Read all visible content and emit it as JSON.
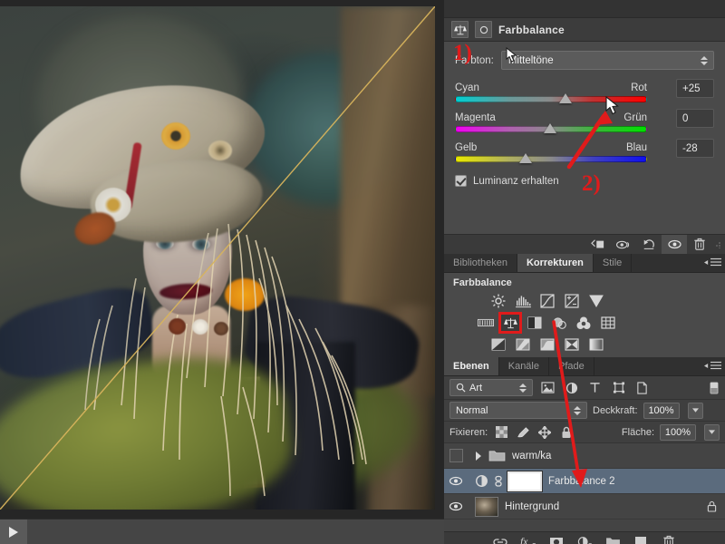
{
  "app": "Adobe Photoshop",
  "canvas": {
    "image_description": "Woman in Halloween scarecrow costume with burlap hat, straw hair and plaid top",
    "split_preview": "diagonal before/after divider",
    "player": {
      "play_label": "play-triangle"
    }
  },
  "properties_panel": {
    "title": "Farbbalance",
    "title_icon": "color-balance-icon",
    "clip_icon": "clip-to-layer-icon",
    "tone": {
      "label": "Farbton:",
      "value": "Mitteltöne"
    },
    "sliders": [
      {
        "left": "Cyan",
        "right": "Rot",
        "value": "+25",
        "thumb_pct": 57,
        "id": "cyan-red"
      },
      {
        "left": "Magenta",
        "right": "Grün",
        "value": "0",
        "thumb_pct": 49,
        "id": "magenta-green"
      },
      {
        "left": "Gelb",
        "right": "Blau",
        "value": "-28",
        "thumb_pct": 36,
        "id": "yellow-blue"
      }
    ],
    "preserve_luminosity": {
      "label": "Luminanz erhalten",
      "checked": true
    },
    "toolbar": [
      {
        "name": "clip-to-layer-button"
      },
      {
        "name": "view-previous-state-button"
      },
      {
        "name": "reset-button"
      },
      {
        "name": "toggle-visibility-button"
      },
      {
        "name": "delete-adjustment-button"
      }
    ]
  },
  "corrections_panel": {
    "tabs": [
      {
        "label": "Bibliotheken",
        "active": false
      },
      {
        "label": "Korrekturen",
        "active": true
      },
      {
        "label": "Stile",
        "active": false
      }
    ],
    "heading": "Farbbalance",
    "icon_rows": [
      [
        "brightness-contrast-icon",
        "levels-icon",
        "curves-icon",
        "exposure-icon",
        "vibrance-icon"
      ],
      [
        "hue-saturation-icon",
        "color-balance-icon",
        "black-white-icon",
        "photo-filter-icon",
        "channel-mixer-icon",
        "color-lookup-icon"
      ],
      [
        "invert-icon",
        "posterize-icon",
        "threshold-icon",
        "selective-color-icon",
        "gradient-map-icon"
      ]
    ],
    "selected_icon": "color-balance-icon",
    "menu_icon": "panel-menu-icon"
  },
  "layers_panel": {
    "tabs": [
      {
        "label": "Ebenen",
        "active": true
      },
      {
        "label": "Kanäle",
        "active": false
      },
      {
        "label": "Pfade",
        "active": false
      }
    ],
    "filter": {
      "kind_label": "Art",
      "search_icon": "search-icon",
      "type_icons": [
        "pixel-filter-icon",
        "adjustment-filter-icon",
        "text-filter-icon",
        "shape-filter-icon",
        "smartobject-filter-icon"
      ],
      "toggle_icon": "filter-toggle-icon"
    },
    "blend_mode": "Normal",
    "opacity": {
      "label": "Deckkraft:",
      "value": "100%"
    },
    "lock": {
      "label": "Fixieren:",
      "icons": [
        "lock-transparency-icon",
        "lock-image-icon",
        "lock-position-icon",
        "lock-all-icon"
      ]
    },
    "fill": {
      "label": "Fläche:",
      "value": "100%"
    },
    "rows": [
      {
        "name": "warm/ka",
        "type": "group",
        "visible": false,
        "selected": false,
        "expand_icon": "chevron-right-icon",
        "folder_icon": "folder-icon"
      },
      {
        "name": "Farbbalance 2",
        "type": "adjustment",
        "visible": true,
        "selected": true,
        "adj_icon": "color-balance-layer-icon",
        "link_icon": "mask-link-icon",
        "mask": "white-mask"
      },
      {
        "name": "Hintergrund",
        "type": "image",
        "visible": true,
        "selected": false,
        "locked": true,
        "lock_icon": "lock-icon"
      }
    ],
    "bottom_buttons": [
      "link-layers-icon",
      "layer-style-fx-icon",
      "add-mask-icon",
      "new-adjustment-icon",
      "new-group-icon",
      "new-layer-icon",
      "delete-layer-icon"
    ]
  },
  "annotations": [
    {
      "label": "1)",
      "target": "color-balance-adjustment-icon"
    },
    {
      "label": "2)",
      "target": "cyan-red-slider-handle"
    }
  ],
  "colors": {
    "panel_bg": "#4a4a4a",
    "panel_dark": "#3a3a3a",
    "selected_layer": "#5b6b7d",
    "annotation_red": "#e01b1b",
    "text": "#d4d4d4"
  }
}
